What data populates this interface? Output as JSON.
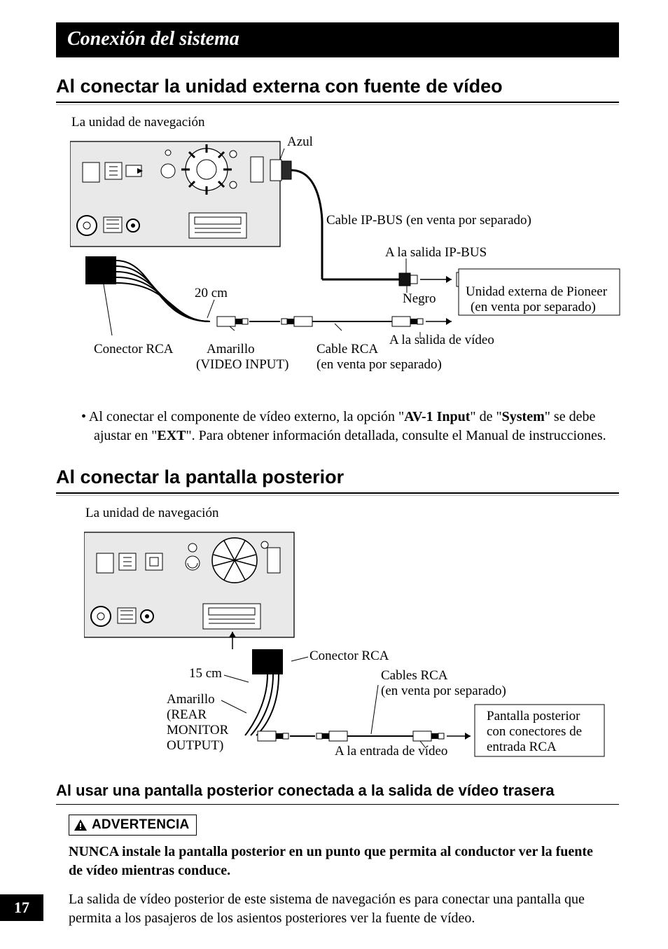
{
  "title_bar": "Conexión del sistema",
  "section1_heading": "Al conectar la unidad externa con fuente de vídeo",
  "diagram1": {
    "caption": "La unidad de navegación",
    "azul": "Azul",
    "cable_ipbus": "Cable IP-BUS (en venta por separado)",
    "a_salida_ipbus": "A la salida IP-BUS",
    "len20": "20 cm",
    "negro": "Negro",
    "unidad_externa_l1": "Unidad externa de Pioneer",
    "unidad_externa_l2": "(en venta por separado)",
    "a_salida_video": "A la salida de vídeo",
    "conector_rca": "Conector RCA",
    "amarillo_l1": "Amarillo",
    "amarillo_l2": "(VIDEO INPUT)",
    "cable_rca_l1": "Cable RCA",
    "cable_rca_l2": "(en venta por separado)"
  },
  "note1_prefix": "•  Al conectar el componente de vídeo externo, la opción \"",
  "note1_b1": "AV-1 Input",
  "note1_mid1": "\" de \"",
  "note1_b2": "System",
  "note1_mid2": "\" se debe ajustar en \"",
  "note1_b3": "EXT",
  "note1_suffix": "\". Para obtener información detallada, consulte el Manual de instrucciones.",
  "section2_heading": "Al conectar la pantalla posterior",
  "diagram2": {
    "caption": "La unidad de navegación",
    "conector_rca": "Conector RCA",
    "len15": "15 cm",
    "cables_rca_l1": "Cables RCA",
    "cables_rca_l2": "(en venta por separado)",
    "amarillo_l1": "Amarillo",
    "amarillo_l2": "(REAR",
    "amarillo_l3": "MONITOR",
    "amarillo_l4": "OUTPUT)",
    "pantalla_l1": "Pantalla posterior",
    "pantalla_l2": "con conectores de",
    "pantalla_l3": "entrada RCA",
    "a_entrada": "A la entrada de vídeo"
  },
  "section3_heading": "Al usar una pantalla posterior conectada a la salida de vídeo trasera",
  "warn_label": "ADVERTENCIA",
  "warn_bold": "NUNCA instale la pantalla posterior en un punto que permita al conductor ver la fuente de vídeo mientras conduce.",
  "warn_para": "La salida de vídeo posterior de este sistema de navegación es para conectar una pantalla que permita a los pasajeros de los asientos posteriores ver la fuente de vídeo.",
  "page_number": "17"
}
